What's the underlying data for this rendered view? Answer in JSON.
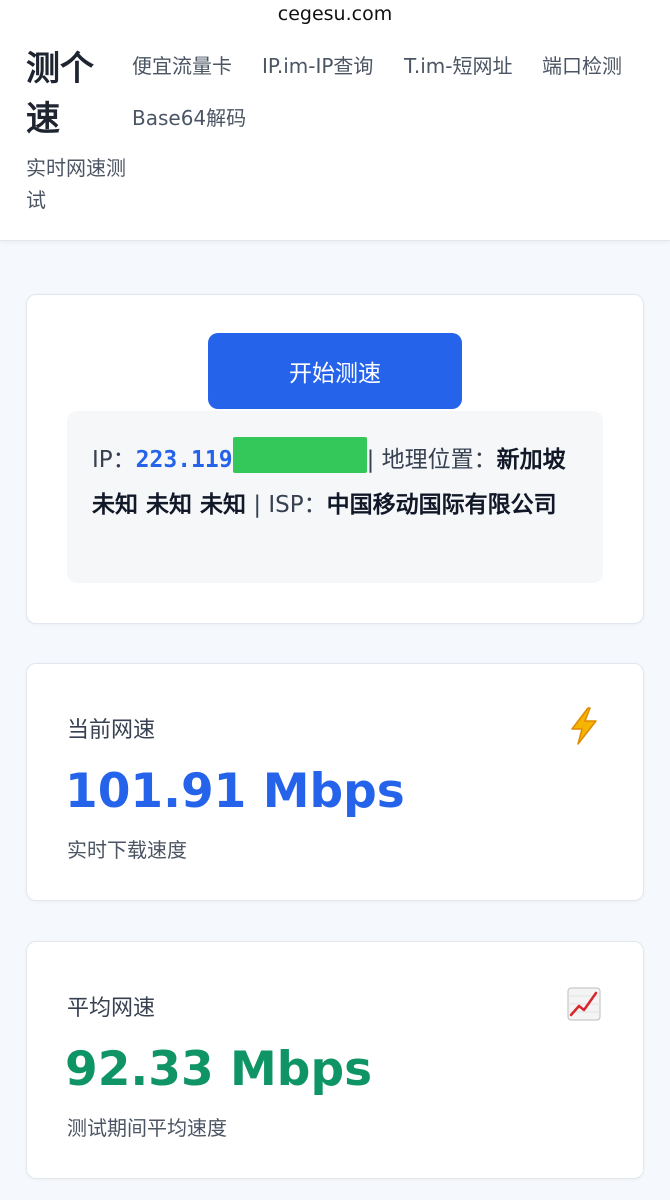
{
  "browser": {
    "url": "cegesu.com"
  },
  "brand": {
    "title": "测个速",
    "subtitle": "实时网速测试"
  },
  "nav": {
    "items": [
      {
        "label": "便宜流量卡"
      },
      {
        "label": "IP.im-IP查询"
      },
      {
        "label": "T.im-短网址"
      },
      {
        "label": "端口检测"
      },
      {
        "label": "Base64解码"
      }
    ]
  },
  "test": {
    "start_label": "开始测速",
    "ip_label": "IP：",
    "ip_value": "223.119",
    "location_label": "| 地理位置：",
    "location_value": "新加坡 未知 未知 未知",
    "isp_label": " | ISP：",
    "isp_value": "中国移动国际有限公司"
  },
  "current": {
    "label": "当前网速",
    "icon": "lightning-icon",
    "value": "101.91 Mbps",
    "desc": "实时下载速度",
    "color": "#2563eb"
  },
  "average": {
    "label": "平均网速",
    "icon": "chart-increasing-icon",
    "value": "92.33 Mbps",
    "desc": "测试期间平均速度",
    "color": "#0f9466"
  }
}
